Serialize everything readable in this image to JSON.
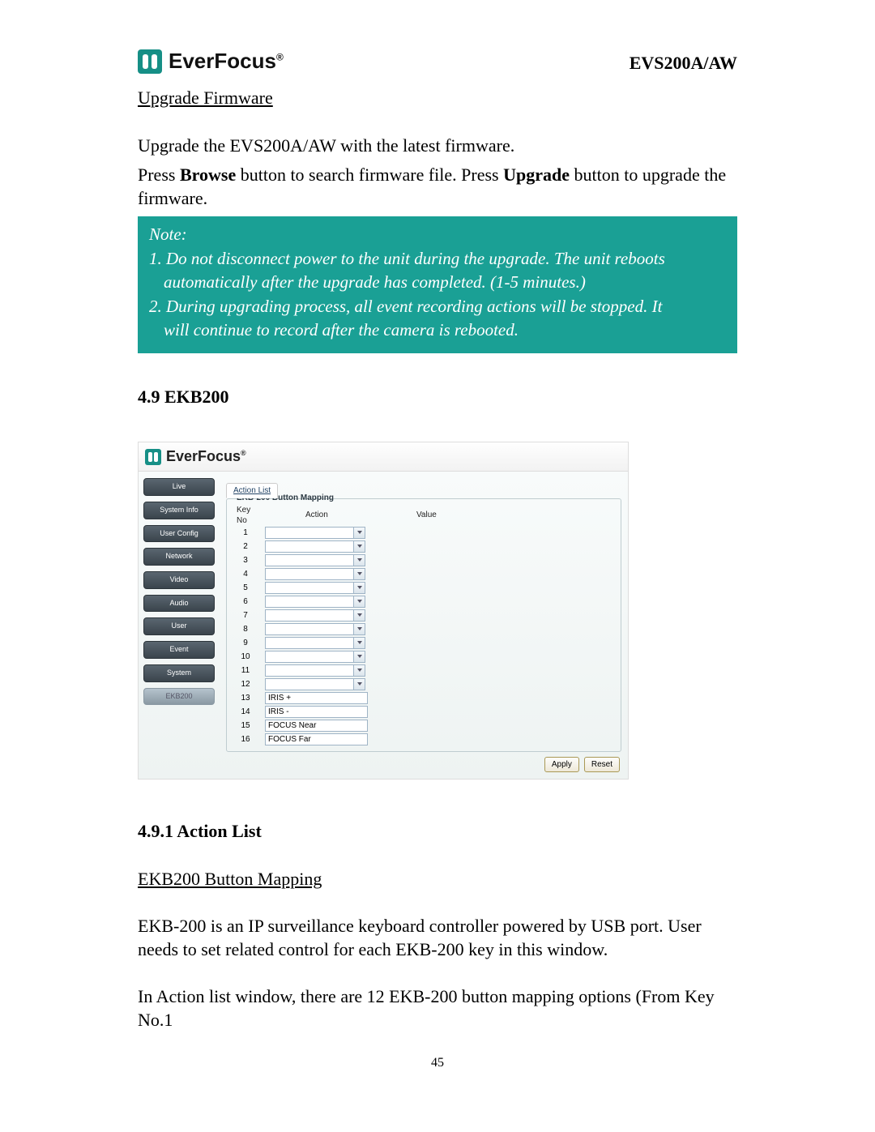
{
  "header": {
    "brand": "EverFocus",
    "model": "EVS200A/AW"
  },
  "doc": {
    "firmware_heading": "Upgrade Firmware",
    "firmware_intro": "Upgrade the EVS200A/AW with the latest firmware.",
    "press_prefix": "Press ",
    "browse_word": "Browse",
    "press_mid": " button to search firmware file. Press ",
    "upgrade_word": "Upgrade",
    "press_suffix": " button to upgrade the firmware.",
    "note_label": "Note:",
    "note1a": "1. Do not disconnect power to the unit during the upgrade. The unit reboots",
    "note1b": "automatically after the upgrade has completed. (1-5 minutes.)",
    "note2a": "2. During upgrading process, all event recording actions will be stopped. It",
    "note2b": "will continue to record after the camera is rebooted.",
    "section_49": "4.9 EKB200",
    "section_491": "4.9.1 Action List",
    "ekb_button_mapping": "EKB200 Button Mapping",
    "ekb_desc": "EKB-200 is an IP surveillance keyboard controller powered by USB port. User needs to set related control for each EKB-200 key in this window.",
    "ekb_actionlist_desc": "In Action list window, there are 12 EKB-200 button mapping options (From Key No.1",
    "page_number": "45"
  },
  "app": {
    "brand": "EverFocus",
    "sidebar": [
      {
        "label": "Live",
        "selected": false
      },
      {
        "label": "System Info",
        "selected": false
      },
      {
        "label": "User Config",
        "selected": false
      },
      {
        "label": "Network",
        "selected": false
      },
      {
        "label": "Video",
        "selected": false
      },
      {
        "label": "Audio",
        "selected": false
      },
      {
        "label": "User",
        "selected": false
      },
      {
        "label": "Event",
        "selected": false
      },
      {
        "label": "System",
        "selected": false
      },
      {
        "label": "EKB200",
        "selected": true
      }
    ],
    "tab_label": "Action List",
    "fieldset_title": "EKB-200 Button Mapping",
    "cols": {
      "keyno": "Key No",
      "action": "Action",
      "value": "Value"
    },
    "rows": [
      {
        "key": "1",
        "type": "select",
        "action": ""
      },
      {
        "key": "2",
        "type": "select",
        "action": ""
      },
      {
        "key": "3",
        "type": "select",
        "action": ""
      },
      {
        "key": "4",
        "type": "select",
        "action": ""
      },
      {
        "key": "5",
        "type": "select",
        "action": ""
      },
      {
        "key": "6",
        "type": "select",
        "action": ""
      },
      {
        "key": "7",
        "type": "select",
        "action": ""
      },
      {
        "key": "8",
        "type": "select",
        "action": ""
      },
      {
        "key": "9",
        "type": "select",
        "action": ""
      },
      {
        "key": "10",
        "type": "select",
        "action": ""
      },
      {
        "key": "11",
        "type": "select",
        "action": ""
      },
      {
        "key": "12",
        "type": "select",
        "action": ""
      },
      {
        "key": "13",
        "type": "text",
        "action": "IRIS +"
      },
      {
        "key": "14",
        "type": "text",
        "action": "IRIS -"
      },
      {
        "key": "15",
        "type": "text",
        "action": "FOCUS Near"
      },
      {
        "key": "16",
        "type": "text",
        "action": "FOCUS Far"
      }
    ],
    "buttons": {
      "apply": "Apply",
      "reset": "Reset"
    }
  }
}
